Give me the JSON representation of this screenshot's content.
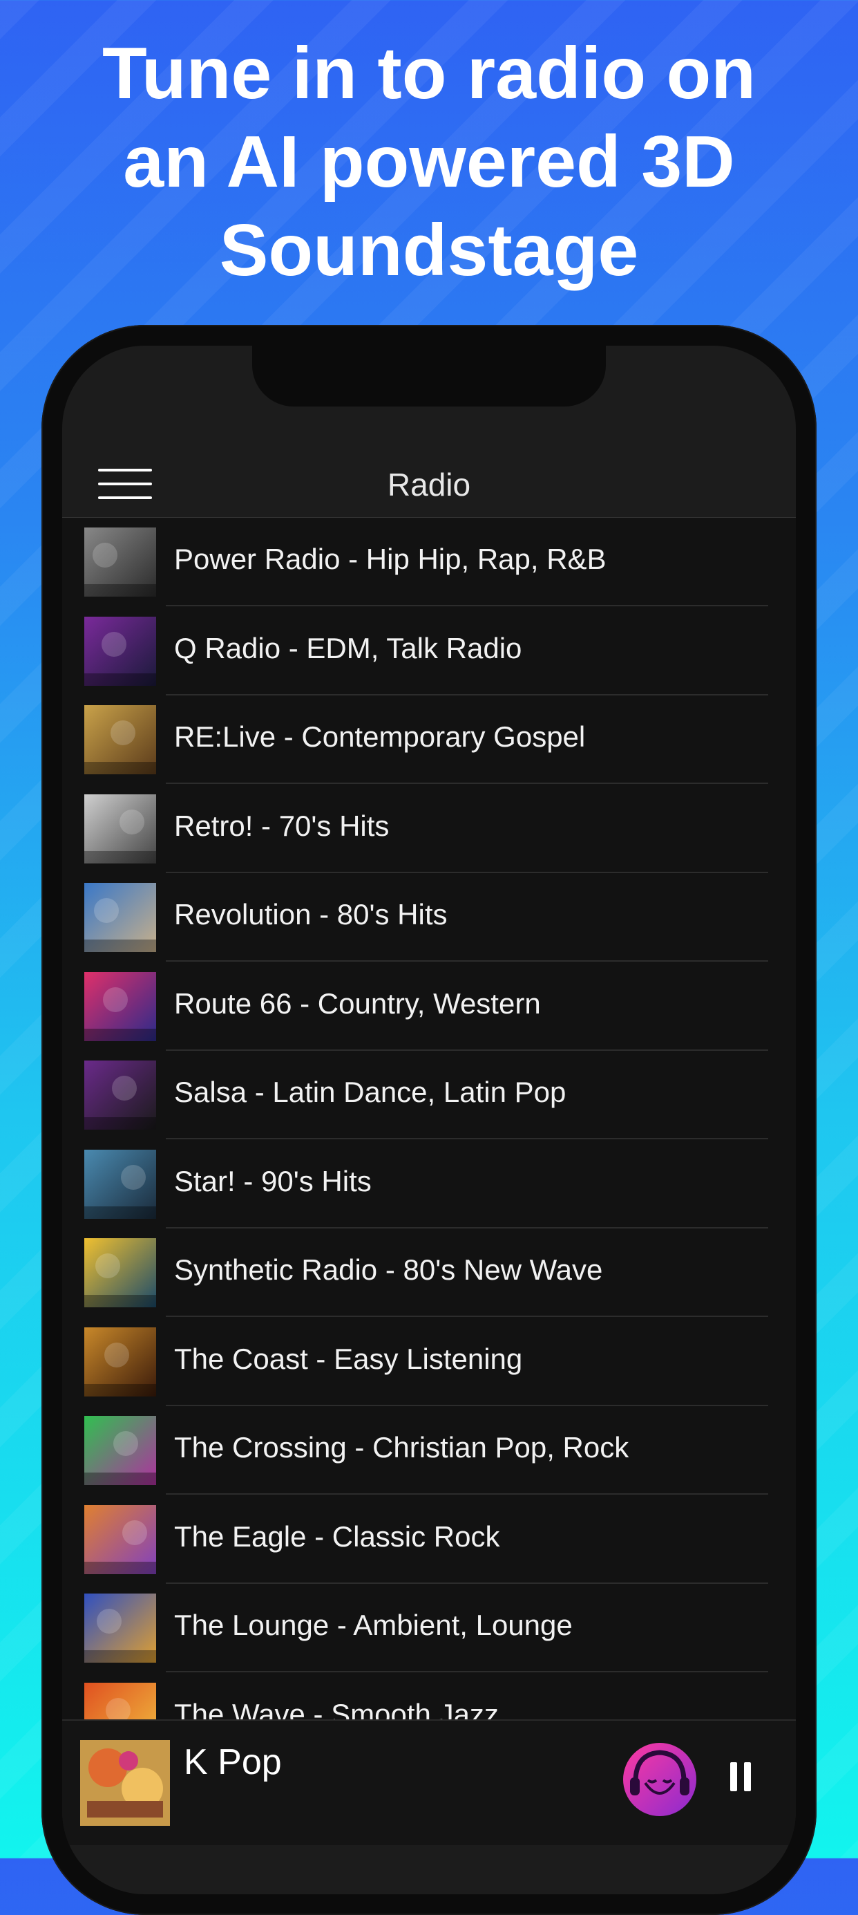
{
  "headline": {
    "line1": "Tune in to radio on",
    "line2": "an AI powered 3D",
    "line3": "Soundstage"
  },
  "navbar": {
    "title": "Radio",
    "menu_icon": "hamburger-menu-icon"
  },
  "stations": [
    {
      "label": "Power Radio - Hip Hip, Rap, R&B",
      "art": "zen-stones-art",
      "colors": [
        "#888888",
        "#2a2a2a"
      ]
    },
    {
      "label": "Q Radio - EDM, Talk Radio",
      "art": "area-51-art",
      "colors": [
        "#7a2a9a",
        "#1a1a3a"
      ]
    },
    {
      "label": "RE:Live - Contemporary Gospel",
      "art": "classic-one-art",
      "colors": [
        "#c9a24a",
        "#5a3a1a"
      ]
    },
    {
      "label": "Retro! - 70's Hits",
      "art": "jazz-art",
      "colors": [
        "#cfcfcf",
        "#444444"
      ]
    },
    {
      "label": "Revolution - 80's Hits",
      "art": "highway-art",
      "colors": [
        "#3a78c8",
        "#c8b08a"
      ]
    },
    {
      "label": "Route 66 - Country, Western",
      "art": "awesome-80s-art",
      "colors": [
        "#e0306a",
        "#2a2a8a"
      ]
    },
    {
      "label": "Salsa - Latin Dance, Latin Pop",
      "art": "car-art",
      "colors": [
        "#6a2a8a",
        "#1a1a1a"
      ]
    },
    {
      "label": "Star! - 90's Hits",
      "art": "blues-town-art",
      "colors": [
        "#4a8ab0",
        "#1a2a3a"
      ]
    },
    {
      "label": "Synthetic Radio - 80's New Wave",
      "art": "the-wave-art",
      "colors": [
        "#f0c030",
        "#1a4a6a"
      ]
    },
    {
      "label": "The Coast - Easy Listening",
      "art": "retro-art",
      "colors": [
        "#c8882a",
        "#3a1a0a"
      ]
    },
    {
      "label": "The Crossing - Christian Pop, Rock",
      "art": "radio-art",
      "colors": [
        "#30c050",
        "#b030a0"
      ]
    },
    {
      "label": "The Eagle - Classic Rock",
      "art": "psychedelic-art",
      "colors": [
        "#e08030",
        "#8040c0"
      ]
    },
    {
      "label": "The Lounge - Ambient, Lounge",
      "art": "bang-art",
      "colors": [
        "#3050c0",
        "#e0a030"
      ]
    },
    {
      "label": "The Wave - Smooth Jazz",
      "art": "indie-nation-art",
      "colors": [
        "#e05020",
        "#f0c040"
      ]
    }
  ],
  "player": {
    "now_playing": "K Pop",
    "art": "k-pop-art",
    "avatar_icon": "listener-avatar-icon",
    "pause_icon": "pause-icon"
  }
}
